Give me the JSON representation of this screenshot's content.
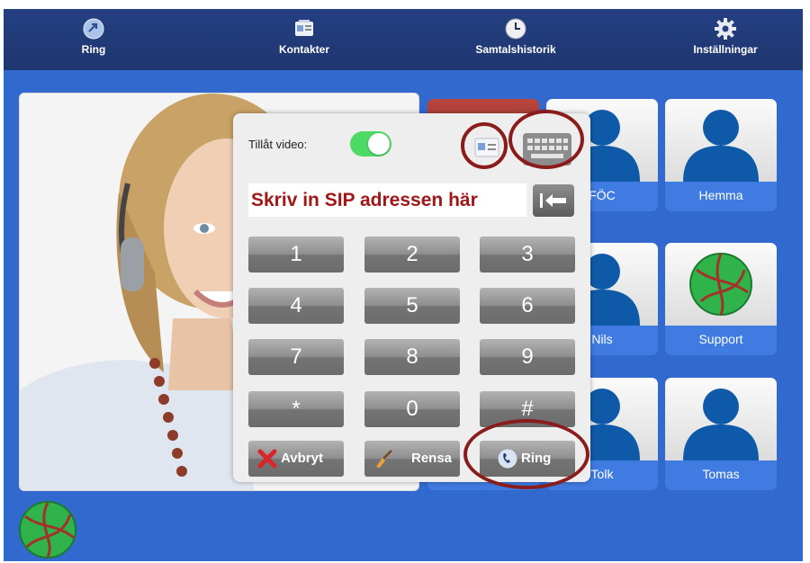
{
  "nav": {
    "items": [
      {
        "label": "Ring",
        "icon": "phone-arrow-icon"
      },
      {
        "label": "Kontakter",
        "icon": "contacts-card-icon"
      },
      {
        "label": "Samtalshistorik",
        "icon": "clock-icon"
      },
      {
        "label": "Inställningar",
        "icon": "gear-icon"
      }
    ]
  },
  "dialer": {
    "video_label": "Tillåt video:",
    "video_enabled": true,
    "sip_placeholder": "Skriv in SIP adressen här",
    "keys": [
      "1",
      "2",
      "3",
      "4",
      "5",
      "6",
      "7",
      "8",
      "9",
      "*",
      "0",
      "#"
    ],
    "cancel_label": "Avbryt",
    "clear_label": "Rensa",
    "call_label": "Ring"
  },
  "contacts": [
    "FÖC",
    "Hemma",
    "Nils",
    "Support",
    "Tolk",
    "Tomas"
  ],
  "colors": {
    "background": "#3269ce",
    "nav": "#243f82",
    "toggle_on": "#4cd964",
    "sip_text": "#a11717",
    "highlight": "#8a1c1c"
  }
}
